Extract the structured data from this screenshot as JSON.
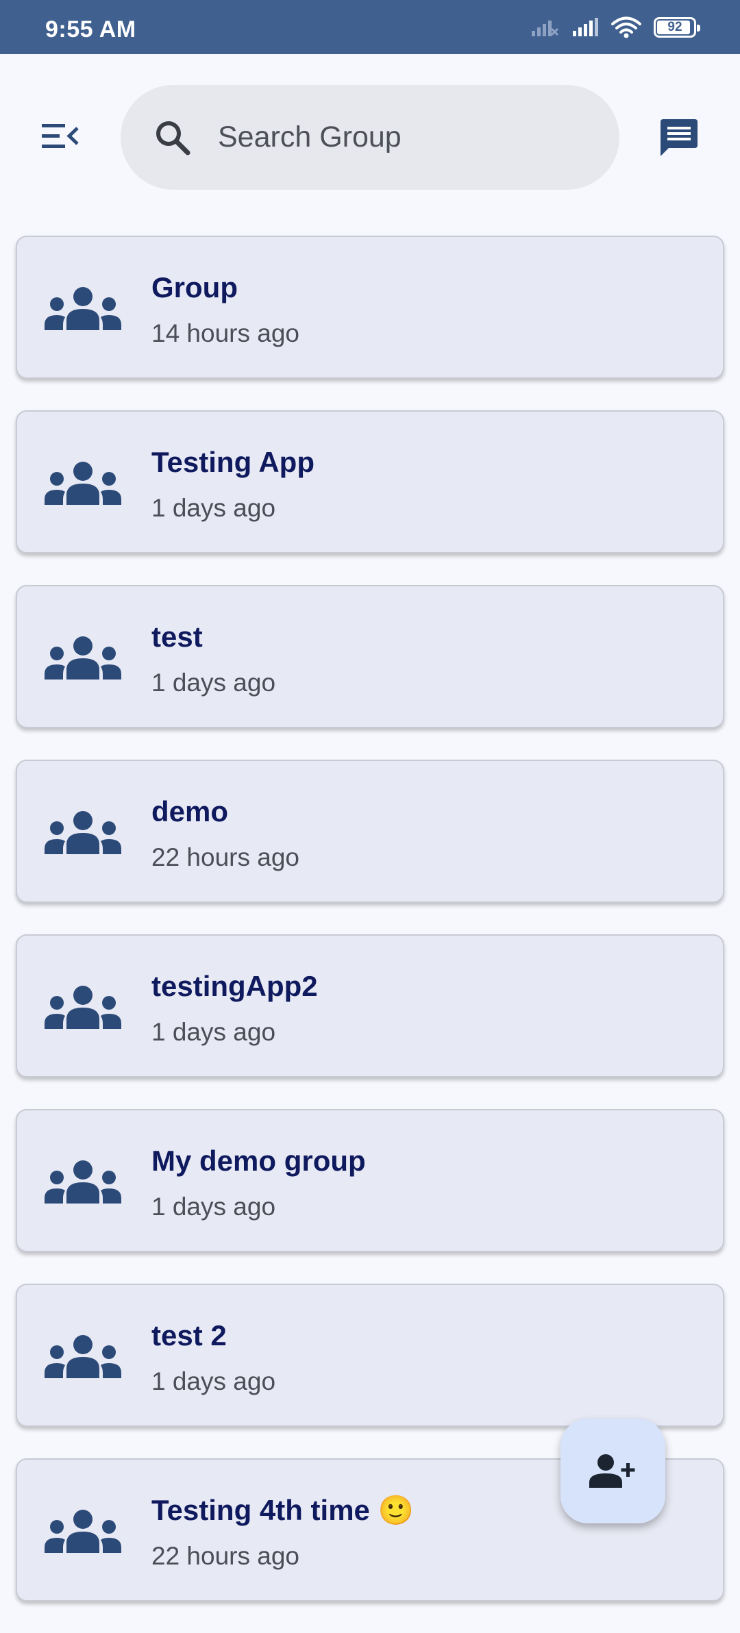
{
  "status_bar": {
    "time": "9:55 AM",
    "battery_level": "92",
    "icons": [
      "signal-off-icon",
      "signal-icon",
      "wifi-icon",
      "battery-icon"
    ]
  },
  "header": {
    "menu_icon": "menu-collapse-icon",
    "search_icon": "search-icon",
    "search_placeholder": "Search Group",
    "search_value": "",
    "chat_icon": "message-icon"
  },
  "groups": [
    {
      "name": "Group",
      "time": "14 hours ago"
    },
    {
      "name": "Testing App",
      "time": "1 days ago"
    },
    {
      "name": "test",
      "time": "1 days ago"
    },
    {
      "name": "demo",
      "time": "22 hours ago"
    },
    {
      "name": "testingApp2",
      "time": "1 days ago"
    },
    {
      "name": "My demo group",
      "time": "1 days ago"
    },
    {
      "name": "test 2",
      "time": "1 days ago"
    },
    {
      "name": "Testing 4th time 🙂",
      "time": "22 hours ago"
    }
  ],
  "group_icon": "group-icon",
  "fab": {
    "icon": "add-person-icon"
  },
  "colors": {
    "status_bar": "#40608f",
    "icon": "#2c4a78",
    "card_bg": "#e7e9f4",
    "group_name": "#0f1a5e",
    "fab_bg": "#d7e3fb"
  }
}
